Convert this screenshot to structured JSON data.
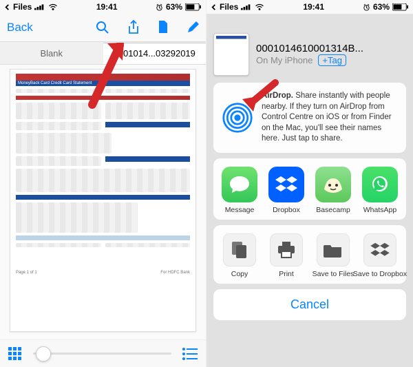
{
  "status": {
    "back_label": "Files",
    "time": "19:41",
    "battery": "63%"
  },
  "leftPane": {
    "toolbar": {
      "back": "Back"
    },
    "tabs": {
      "blank": "Blank",
      "file": "0001014...03292019"
    },
    "doc": {
      "footer_left": "Page 1 of 1",
      "footer_right": "For HDFC Bank"
    }
  },
  "rightPane": {
    "title": "0001014610001314B...",
    "subtitle": "On My iPhone",
    "tag": "+Tag",
    "airdrop": {
      "bold": "AirDrop.",
      "text": " Share instantly with people nearby. If they turn on AirDrop from Control Centre on iOS or from Finder on the Mac, you'll see their names here. Just tap to share."
    },
    "apps": [
      {
        "label": "Message",
        "color": "#4cd964"
      },
      {
        "label": "Dropbox",
        "color": "#0061ff"
      },
      {
        "label": "Basecamp",
        "color": "#6ad56a"
      },
      {
        "label": "WhatsApp",
        "color": "#25d366"
      }
    ],
    "actions": [
      {
        "label": "Copy"
      },
      {
        "label": "Print"
      },
      {
        "label": "Save to Files"
      },
      {
        "label": "Save to Dropbox"
      }
    ],
    "cancel": "Cancel"
  }
}
